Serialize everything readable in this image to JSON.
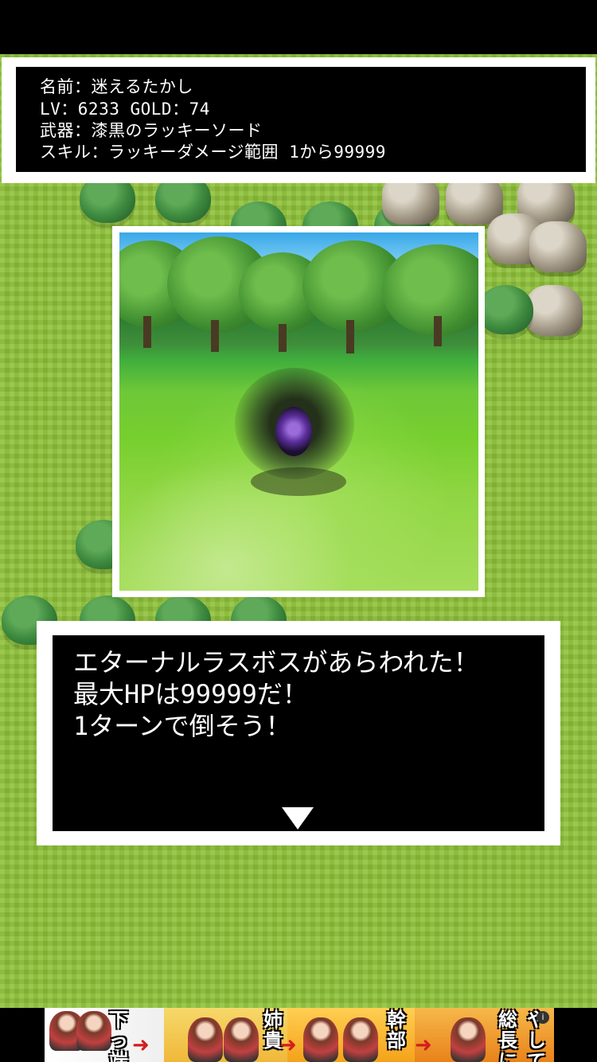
{
  "status": {
    "name_line": "名前：迷えるたかし",
    "level_gold_line": "LV：6233 GOLD：74",
    "weapon_line": "武器：漆黒のラッキーソード",
    "skill_line": "スキル：ラッキーダメージ範囲 1から99999"
  },
  "message": {
    "text": "エターナルラスボスがあらわれた！\n最大HPは99999だ！\n1ターンで倒そう！",
    "next_icon": "triangle-down-icon"
  },
  "ad_banner": {
    "labels": [
      "下っ端",
      "姉貴",
      "幹部",
      "総長に"
    ],
    "end_label": "やして",
    "info_icon": "info-icon"
  },
  "colors": {
    "grass": "#8fc23a",
    "window_bg": "#000000",
    "window_border": "#ffffff",
    "text": "#ffffff",
    "ad_arrow": "#d21e1e"
  }
}
